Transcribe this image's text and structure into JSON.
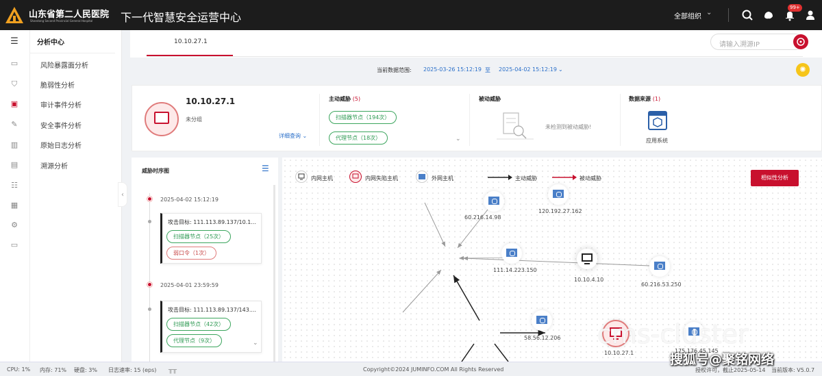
{
  "header": {
    "brand": "山东省第二人民医院",
    "brand_sub": "Shandong Second Provincial General Hospital",
    "app_title": "下一代智慧安全运营中心",
    "org_select": "全部组织",
    "badge": "99+"
  },
  "sidebar": {
    "title": "分析中心",
    "items": [
      {
        "label": "风险暴露面分析"
      },
      {
        "label": "脆弱性分析"
      },
      {
        "label": "审计事件分析"
      },
      {
        "label": "安全事件分析"
      },
      {
        "label": "原始日志分析"
      },
      {
        "label": "溯源分析"
      }
    ]
  },
  "main": {
    "tab": "10.10.27.1",
    "search_placeholder": "请输入溯源IP",
    "range_label": "当前数据范围:",
    "range_start": "2025-03-26 15:12:19",
    "range_to": "至",
    "range_end": "2025-04-02 15:12:19"
  },
  "summary": {
    "ip": "10.10.27.1",
    "group": "未分组",
    "detail_link": "详细查询",
    "active_title": "主动威胁",
    "active_count": "(5)",
    "active_tags": [
      "扫描器节点（194次）",
      "代理节点（18次）"
    ],
    "passive_title": "被动威胁",
    "passive_empty": "未检测到被动威胁!",
    "source_title": "数据来源",
    "source_count": "(1)",
    "source_app": "应用系统"
  },
  "timeline": {
    "title": "威胁时序图",
    "events": [
      {
        "time": "2025-04-02 15:12:19",
        "target": "攻击目标: 111.113.89.137/10.1...",
        "tags": [
          "扫描器节点（25次）",
          "弱口令（1次）"
        ]
      },
      {
        "time": "2025-04-01 23:59:59",
        "target": "攻击目标: 111.113.89.137/143....",
        "tags": [
          "扫描器节点（42次）",
          "代理节点（9次）"
        ]
      }
    ]
  },
  "graph": {
    "legend": [
      "内网主机",
      "内网失陷主机",
      "外网主机",
      "主动威胁",
      "被动威胁"
    ],
    "similarity_button": "相似性分析",
    "nodes": [
      "120.192.27.162",
      "60.216.14.98",
      "111.14.223.150",
      "10.10.4.10",
      "60.216.53.250",
      "58.56.12.206",
      "10.10.27.1",
      "175.176.45.145"
    ]
  },
  "statusbar": {
    "cpu": "CPU: 1%",
    "mem": "内存: 71%",
    "disk": "硬盘: 3%",
    "rate": "日志速率: 15 (eps)",
    "copyright": "Copyright©2024 JUMINFO.COM All Rights Reserved",
    "license": "授权许可，截止2025-05-14",
    "version": "当前版本: V5.0.7"
  },
  "watermark": {
    "main": "cms-cluster",
    "sub": "搜狐号@聚铭网络"
  },
  "colors": {
    "accent": "#c8102e",
    "link": "#2a6fc9",
    "tag_green": "#3ba55d",
    "topbar": "#1c1c1c"
  }
}
